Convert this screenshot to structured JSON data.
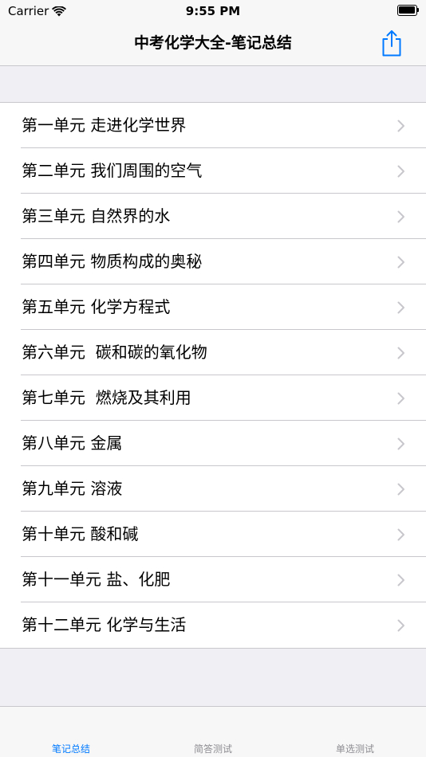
{
  "status_bar": {
    "carrier": "Carrier",
    "time": "9:55 PM"
  },
  "nav": {
    "title": "中考化学大全-笔记总结",
    "share_icon": "share-icon",
    "accent_color": "#007aff"
  },
  "units": [
    {
      "label": "第一单元 走进化学世界"
    },
    {
      "label": "第二单元 我们周围的空气"
    },
    {
      "label": "第三单元 自然界的水"
    },
    {
      "label": "第四单元 物质构成的奥秘"
    },
    {
      "label": "第五单元 化学方程式"
    },
    {
      "label": "第六单元  碳和碳的氧化物"
    },
    {
      "label": "第七单元  燃烧及其利用"
    },
    {
      "label": "第八单元 金属"
    },
    {
      "label": "第九单元 溶液"
    },
    {
      "label": "第十单元 酸和碱"
    },
    {
      "label": "第十一单元 盐、化肥"
    },
    {
      "label": "第十二单元 化学与生活"
    }
  ],
  "tabs": [
    {
      "label": "笔记总结",
      "active": true
    },
    {
      "label": "简答测试",
      "active": false
    },
    {
      "label": "单选测试",
      "active": false
    }
  ]
}
